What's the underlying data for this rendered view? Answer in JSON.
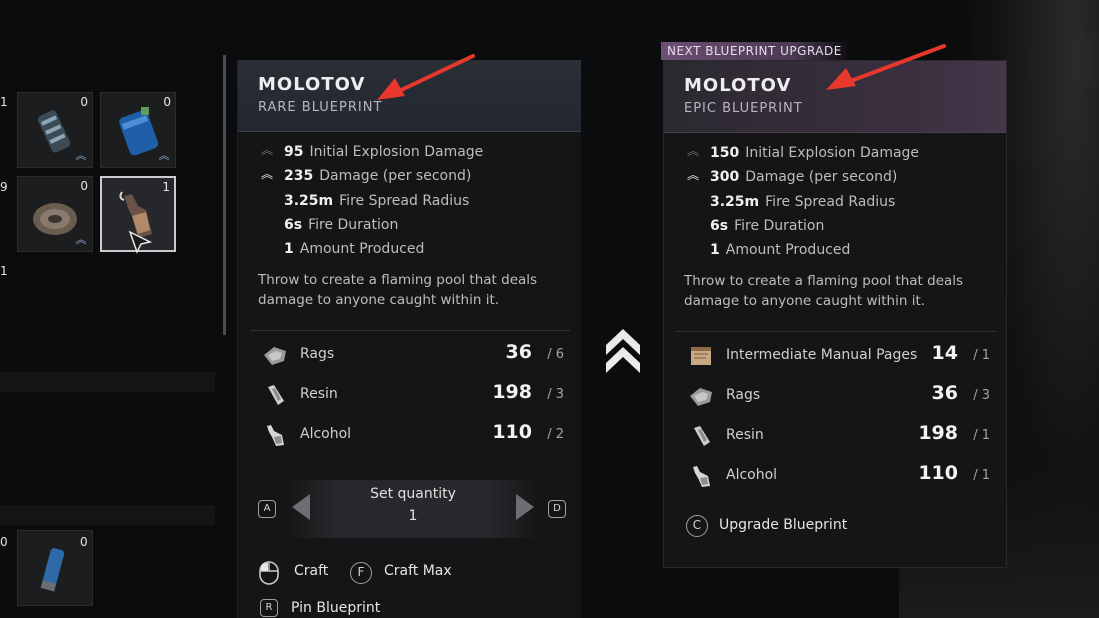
{
  "inventory": {
    "edge_counts": [
      "1",
      "9",
      "1",
      "0"
    ],
    "cells": [
      {
        "count": "0",
        "name": "ammo-canister"
      },
      {
        "count": "0",
        "name": "blue-canister"
      },
      {
        "count": "0",
        "name": "coiled-hose"
      },
      {
        "count": "1",
        "name": "molotov-bottle"
      },
      {
        "count": "0",
        "name": "blue-cylinder"
      }
    ]
  },
  "current": {
    "title": "MOLOTOV",
    "subtitle": "RARE BLUEPRINT",
    "stats": [
      {
        "value": "95",
        "label": "Initial Explosion Damage"
      },
      {
        "value": "235",
        "label": "Damage (per second)"
      },
      {
        "value": "3.25m",
        "label": "Fire Spread Radius"
      },
      {
        "value": "6s",
        "label": "Fire Duration"
      },
      {
        "value": "1",
        "label": "Amount Produced"
      }
    ],
    "description": "Throw to create a flaming pool that deals damage to anyone caught within it.",
    "materials": [
      {
        "name": "Rags",
        "have": "36",
        "need": "/ 6",
        "icon": "rags-icon"
      },
      {
        "name": "Resin",
        "have": "198",
        "need": "/ 3",
        "icon": "resin-icon"
      },
      {
        "name": "Alcohol",
        "have": "110",
        "need": "/ 2",
        "icon": "alcohol-icon"
      }
    ],
    "quantity": {
      "label": "Set quantity",
      "value": "1",
      "key_left": "A",
      "key_right": "D"
    },
    "actions": {
      "craft": "Craft",
      "craft_max_key": "F",
      "craft_max": "Craft Max",
      "pin_key": "R",
      "pin": "Pin Blueprint"
    }
  },
  "upgrade": {
    "tag": "NEXT BLUEPRINT UPGRADE",
    "title": "MOLOTOV",
    "subtitle": "EPIC BLUEPRINT",
    "stats": [
      {
        "value": "150",
        "label": "Initial Explosion Damage"
      },
      {
        "value": "300",
        "label": "Damage (per second)"
      },
      {
        "value": "3.25m",
        "label": "Fire Spread Radius"
      },
      {
        "value": "6s",
        "label": "Fire Duration"
      },
      {
        "value": "1",
        "label": "Amount Produced"
      }
    ],
    "description": "Throw to create a flaming pool that deals damage to anyone caught within it.",
    "materials": [
      {
        "name": "Intermediate Manual Pages",
        "have": "14",
        "need": "/ 1",
        "icon": "manual-pages-icon"
      },
      {
        "name": "Rags",
        "have": "36",
        "need": "/ 3",
        "icon": "rags-icon"
      },
      {
        "name": "Resin",
        "have": "198",
        "need": "/ 1",
        "icon": "resin-icon"
      },
      {
        "name": "Alcohol",
        "have": "110",
        "need": "/ 1",
        "icon": "alcohol-icon"
      }
    ],
    "action": {
      "key": "C",
      "label": "Upgrade Blueprint"
    }
  },
  "colors": {
    "annotation_arrow": "#e8372c",
    "epic_accent": "#6d4f73"
  }
}
